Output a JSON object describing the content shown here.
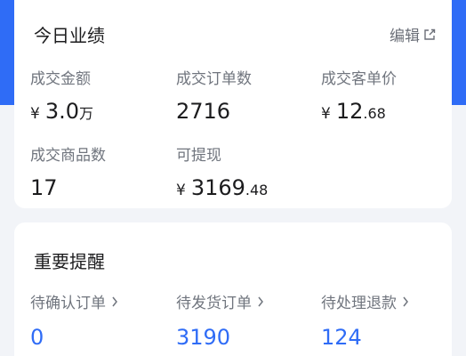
{
  "performance": {
    "title": "今日业绩",
    "edit_label": "编辑",
    "metrics": [
      {
        "label": "成交金额",
        "currency": "¥",
        "int": "3.0",
        "dec": "",
        "unit": "万"
      },
      {
        "label": "成交订单数",
        "currency": "",
        "int": "2716",
        "dec": "",
        "unit": ""
      },
      {
        "label": "成交客单价",
        "currency": "¥",
        "int": "12",
        "dec": ".68",
        "unit": ""
      },
      {
        "label": "成交商品数",
        "currency": "",
        "int": "17",
        "dec": "",
        "unit": ""
      },
      {
        "label": "可提现",
        "currency": "¥",
        "int": "3169",
        "dec": ".48",
        "unit": ""
      }
    ]
  },
  "reminders": {
    "title": "重要提醒",
    "items": [
      {
        "label": "待确认订单",
        "value": "0"
      },
      {
        "label": "待发货订单",
        "value": "3190"
      },
      {
        "label": "待处理退款",
        "value": "124"
      }
    ]
  },
  "colors": {
    "accent": "#2f6cf6",
    "label": "#70757e"
  },
  "icons": {
    "edit": "external-edit-icon",
    "chevron": "chevron-right-icon"
  }
}
